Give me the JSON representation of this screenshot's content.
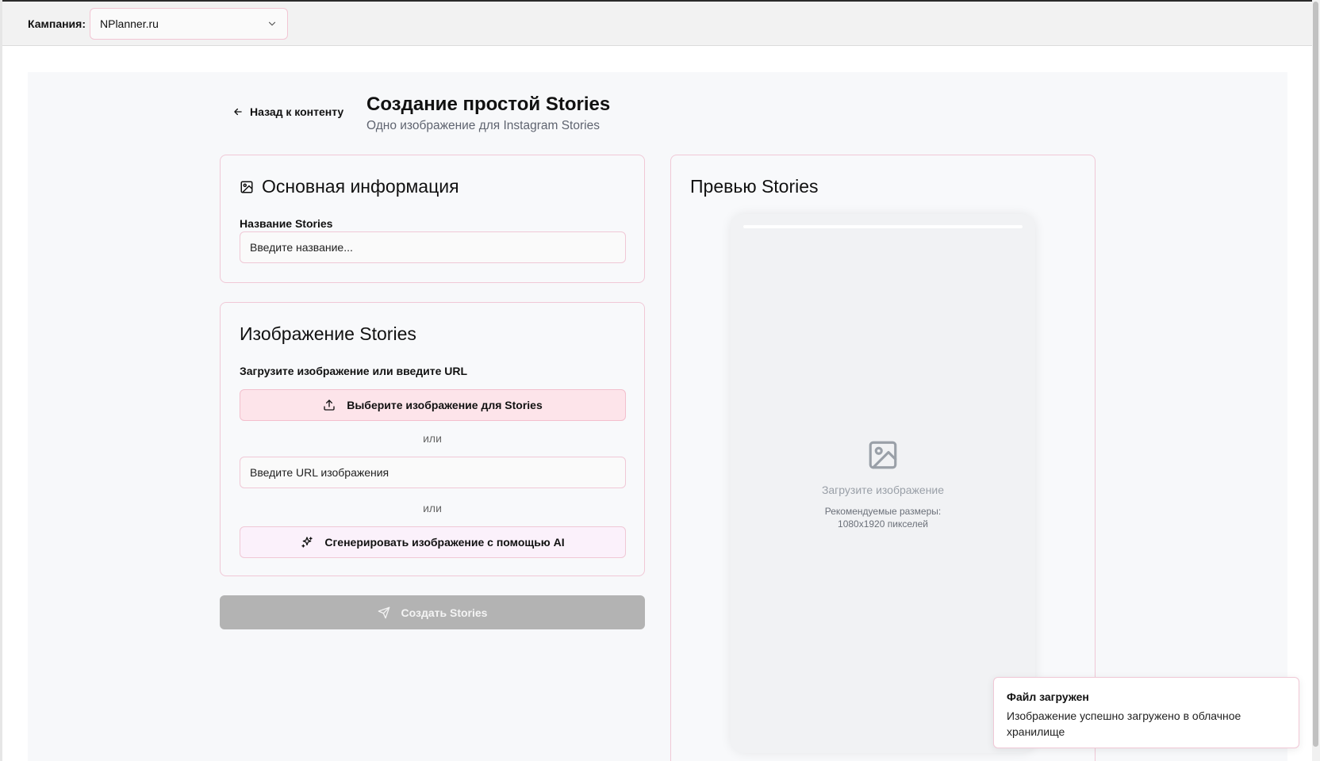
{
  "topbar": {
    "campaign_label": "Кампания:",
    "campaign_value": "NPlanner.ru"
  },
  "header": {
    "back_label": "Назад к контенту",
    "title": "Создание простой Stories",
    "subtitle": "Одно изображение для Instagram Stories"
  },
  "info_card": {
    "title": "Основная информация",
    "name_label": "Название Stories",
    "name_placeholder": "Введите название..."
  },
  "image_card": {
    "title": "Изображение Stories",
    "upload_label": "Загрузите изображение или введите URL",
    "upload_button": "Выберите изображение для Stories",
    "or_text_1": "или",
    "url_placeholder": "Введите URL изображения",
    "or_text_2": "или",
    "ai_button": "Сгенерировать изображение с помощью AI"
  },
  "create_button": "Создать Stories",
  "preview": {
    "title": "Превью Stories",
    "placeholder_text": "Загрузите изображение",
    "hint_line1": "Рекомендуемые размеры:",
    "hint_line2": "1080x1920 пикселей"
  },
  "toast": {
    "title": "Файл загружен",
    "body": "Изображение успешно загружено в облачное хранилище"
  },
  "colors": {
    "accent_border": "#f0c8d6",
    "upload_bg": "#fde4ea",
    "disabled_button": "#b3b3b3"
  }
}
